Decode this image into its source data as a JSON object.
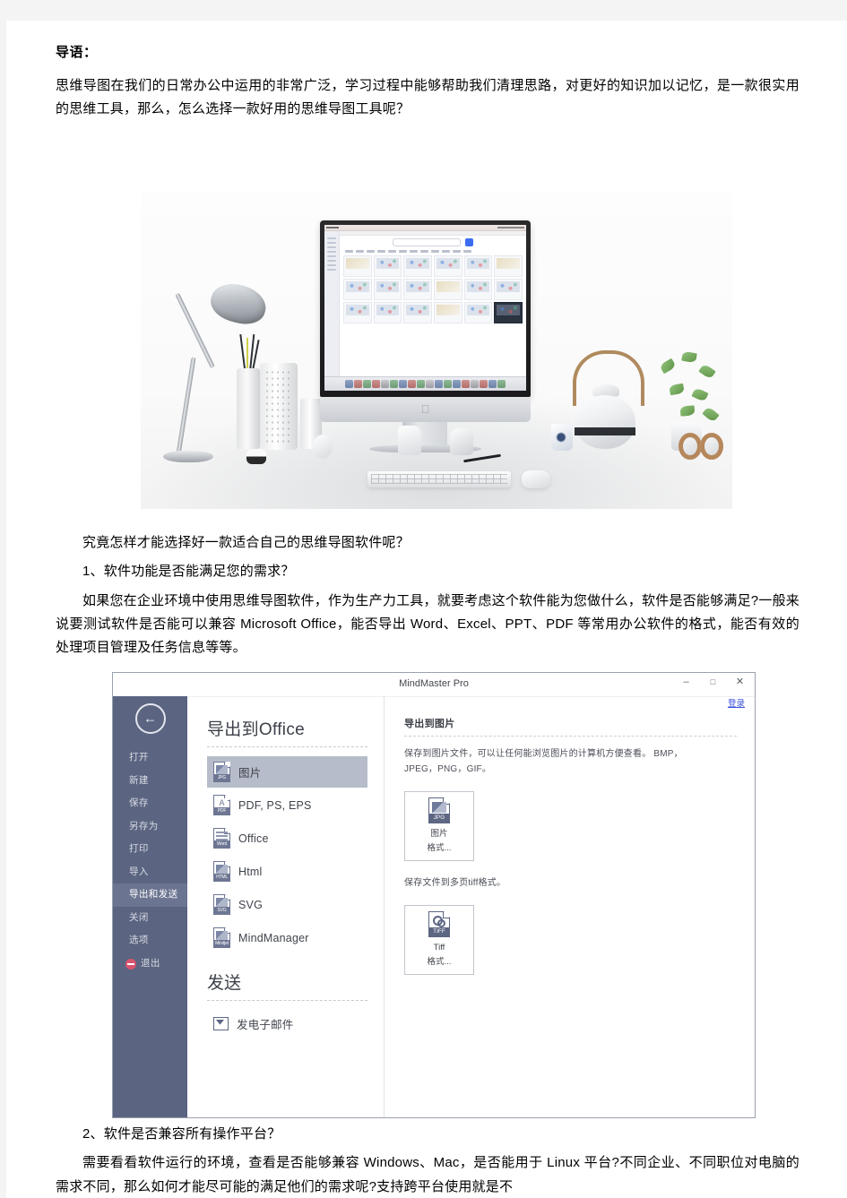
{
  "article": {
    "lead_title": "导语：",
    "lead_paragraph": "思维导图在我们的日常办公中运用的非常广泛，学习过程中能够帮助我们清理思路，对更好的知识加以记忆，是一款很实用的思维工具，那么，怎么选择一款好用的思维导图工具呢？",
    "q_intro": "究竟怎样才能选择好一款适合自己的思维导图软件呢？",
    "heading_1": "1、软件功能是否能满足您的需求？",
    "body_1": "如果您在企业环境中使用思维导图软件，作为生产力工具，就要考虑这个软件能为您做什么，软件是否能够满足?一般来说要测试软件是否能可以兼容 Microsoft Office，能否导出 Word、Excel、PPT、PDF 等常用办公软件的格式，能否有效的处理项目管理及任务信息等等。",
    "heading_2": "2、软件是否兼容所有操作平台？",
    "body_2": "需要看看软件运行的环境，查看是否能够兼容 Windows、Mac，是否能用于 Linux 平台?不同企业、不同职位对电脑的需求不同，那么如何才能尽可能的满足他们的需求呢?支持跨平台使用就是不"
  },
  "photo": {
    "alt_name": "desk-scene-imac-mindmap-gallery"
  },
  "mindmaster": {
    "title": "MindMaster Pro",
    "window_buttons": {
      "minimize": "–",
      "maximize": "□",
      "close": "✕"
    },
    "login_link": "登录",
    "back_icon": "back-arrow-icon",
    "nav": [
      {
        "label": "打开",
        "active": false
      },
      {
        "label": "新建",
        "active": false
      },
      {
        "label": "保存",
        "active": false
      },
      {
        "label": "另存为",
        "active": false
      },
      {
        "label": "打印",
        "active": false
      },
      {
        "label": "导入",
        "active": false
      },
      {
        "label": "导出和发送",
        "active": true
      },
      {
        "label": "关闭",
        "active": false
      },
      {
        "label": "选项",
        "active": false
      },
      {
        "label": "退出",
        "active": false
      }
    ],
    "center": {
      "heading": "导出到Office",
      "items": [
        {
          "label": "图片",
          "tag": "JPG",
          "selected": true
        },
        {
          "label": "PDF, PS, EPS",
          "tag": "PDF",
          "selected": false
        },
        {
          "label": "Office",
          "tag": "Word",
          "selected": false
        },
        {
          "label": "Html",
          "tag": "HTML",
          "selected": false
        },
        {
          "label": "SVG",
          "tag": "SVG",
          "selected": false
        },
        {
          "label": "MindManager",
          "tag": "Mindjet",
          "selected": false
        }
      ],
      "send_heading": "发送",
      "send_items": [
        {
          "label": "发电子邮件"
        }
      ]
    },
    "right": {
      "title": "导出到图片",
      "description": "保存到图片文件，可以让任何能浏览图片的计算机方便查看。 BMP，JPEG，PNG，GIF。",
      "image_tile": {
        "tag": "JPG",
        "line1": "图片",
        "line2": "格式..."
      },
      "tiff_description": "保存文件到多页tiff格式。",
      "tiff_tile": {
        "tag": "TIFF",
        "line1": "Tiff",
        "line2": "格式..."
      }
    }
  },
  "colors": {
    "sidebar": "#5b6480",
    "sidebar_active": "#6b7490",
    "selection": "#b6bcc9",
    "link": "#3a4fd6",
    "exit_red": "#d9536f"
  }
}
